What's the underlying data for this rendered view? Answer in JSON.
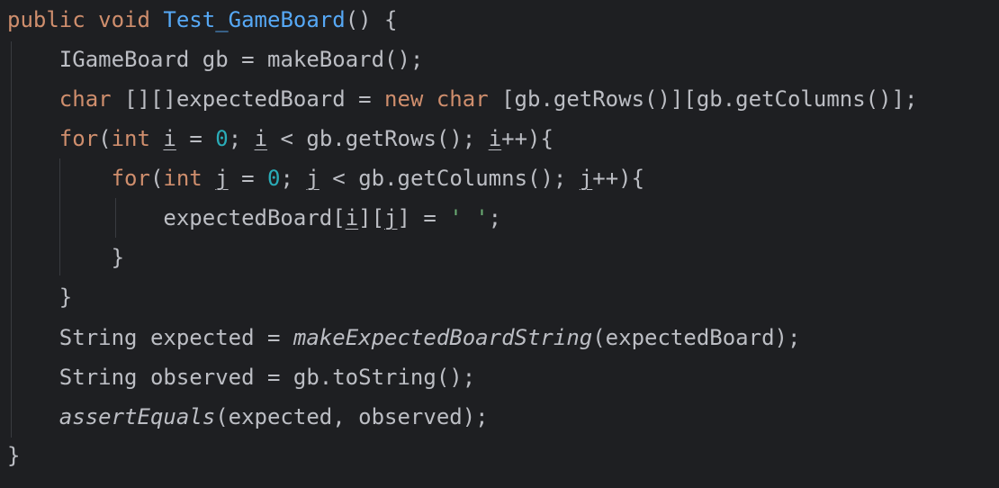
{
  "code": {
    "l1": {
      "kw_public": "public",
      "kw_void": "void",
      "method_name": "Test_GameBoard",
      "rest": "() {"
    },
    "l2": {
      "type": "IGameBoard",
      "rest": " gb = makeBoard();"
    },
    "l3": {
      "kw_char": "char",
      "mid": " [][]expectedBoard = ",
      "kw_new": "new",
      "kw_char2": "char",
      "rest": " [gb.getRows()][gb.getColumns()];"
    },
    "l4": {
      "kw_for": "for",
      "paren": "(",
      "kw_int": "int",
      "var1": "i",
      "eq": " = ",
      "zero": "0",
      "semi": "; ",
      "var2": "i",
      "cond": " < gb.getRows(); ",
      "var3": "i",
      "tail": "++){"
    },
    "l5": {
      "kw_for": "for",
      "paren": "(",
      "kw_int": "int",
      "var1": "j",
      "eq": " = ",
      "zero": "0",
      "semi": "; ",
      "var2": "j",
      "cond": " < gb.getColumns(); ",
      "var3": "j",
      "tail": "++){"
    },
    "l6": {
      "a": "expectedBoard[",
      "vi": "i",
      "b": "][",
      "vj": "j",
      "c": "] = ",
      "str": "' '",
      "d": ";"
    },
    "l7": "}",
    "l8": "}",
    "l9": {
      "a": "String expected = ",
      "fn": "makeExpectedBoardString",
      "b": "(expectedBoard);"
    },
    "l10": "String observed = gb.toString();",
    "l11": {
      "fn": "assertEquals",
      "b": "(expected, observed);"
    },
    "l12": "}"
  },
  "colors": {
    "background": "#1e1f22",
    "keyword": "#cf8e6d",
    "method_declaration": "#56a8f5",
    "number": "#2aacb8",
    "string": "#6aab73",
    "default_text": "#bcbec4"
  }
}
